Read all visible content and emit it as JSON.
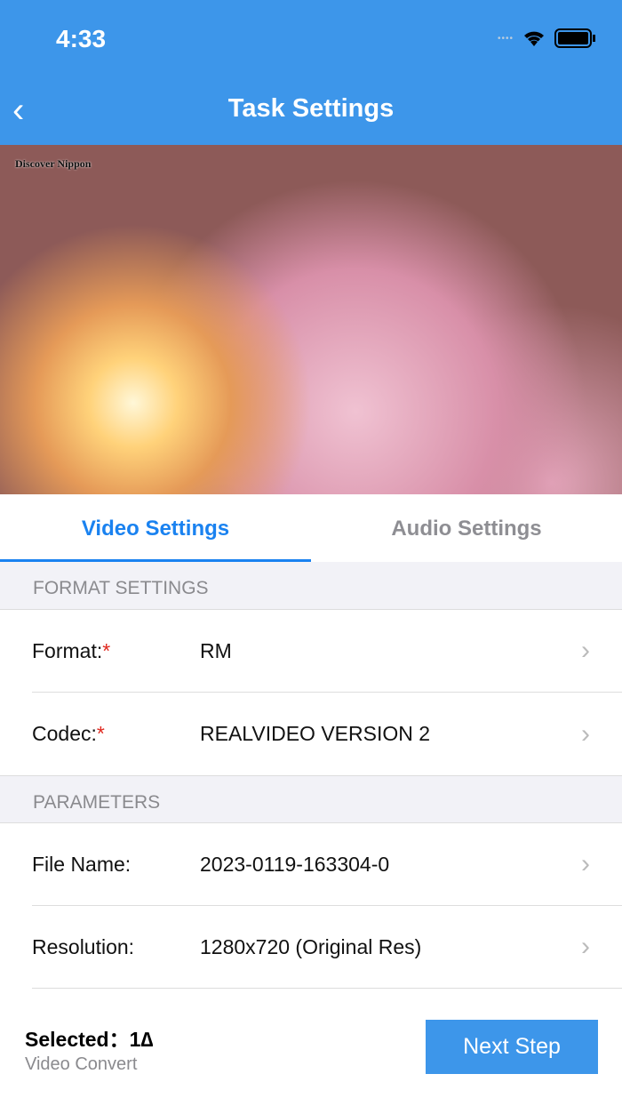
{
  "status_bar": {
    "time": "4:33"
  },
  "header": {
    "title": "Task Settings"
  },
  "video": {
    "watermark": "Discover Nippon"
  },
  "tabs": [
    {
      "label": "Video Settings"
    },
    {
      "label": "Audio Settings"
    }
  ],
  "sections": {
    "format": "FORMAT SETTINGS",
    "params": "PARAMETERS"
  },
  "rows": [
    {
      "label": "Format:",
      "required": "*",
      "value": "RM"
    },
    {
      "label": "Codec:",
      "required": "*",
      "value": "REALVIDEO VERSION 2"
    },
    {
      "label": "File Name:",
      "value": "2023-0119-163304-0"
    },
    {
      "label": "Resolution:",
      "value": "1280x720 (Original Res)"
    }
  ],
  "footer": {
    "selected": "Selected：1∆",
    "subtitle": "Video Convert",
    "next": "Next Step"
  }
}
